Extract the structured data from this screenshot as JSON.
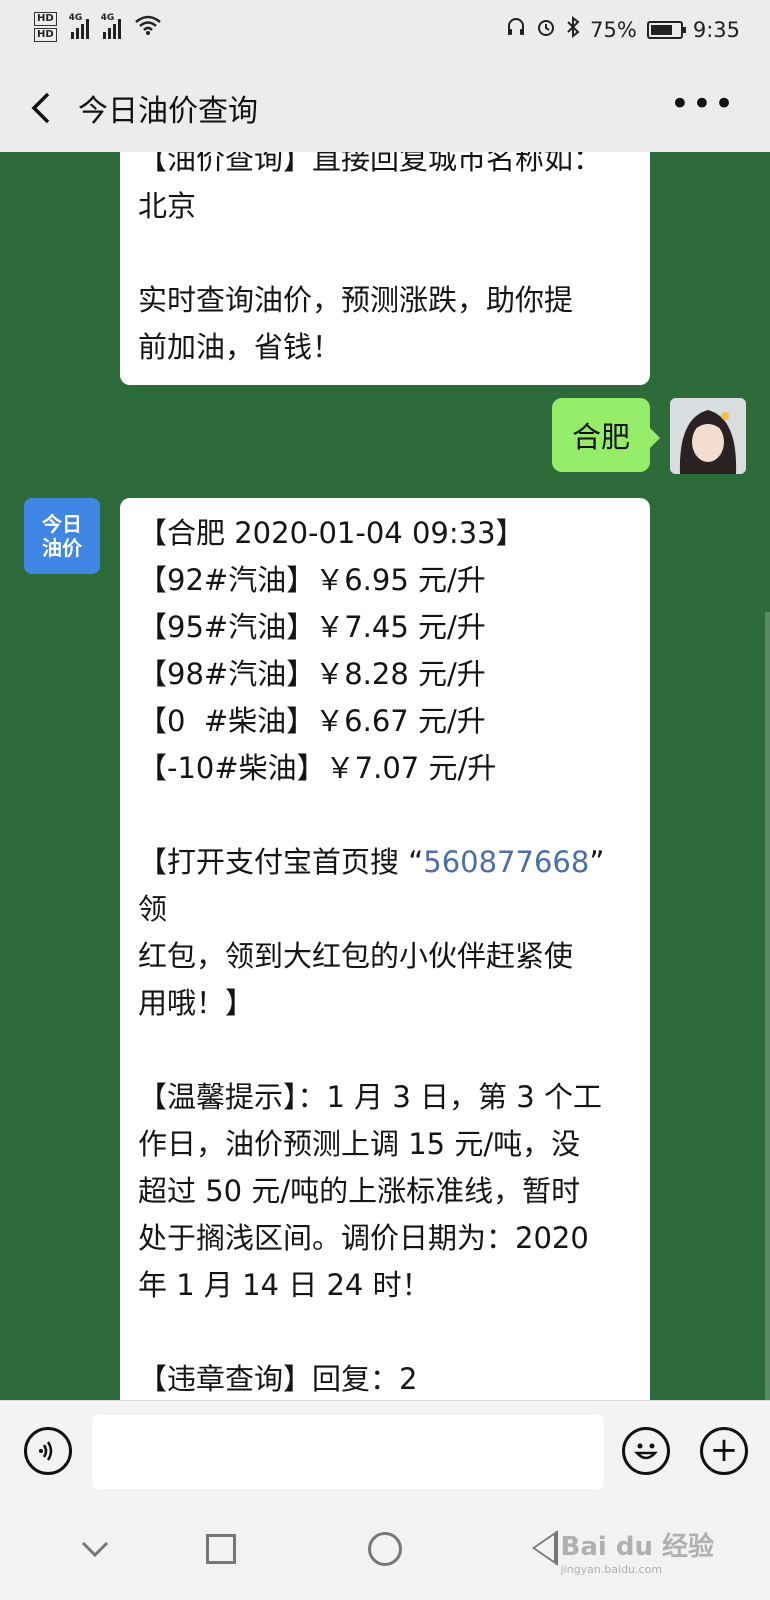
{
  "status": {
    "hd1": "HD",
    "hd2": "HD",
    "net1": "4G",
    "net2": "4G",
    "battery": "75%",
    "battery_level": 0.75,
    "time": "9:35"
  },
  "header": {
    "title": "今日油价查询"
  },
  "messages": {
    "bot_intro": {
      "line1": "【油价查询】直接回复城市名称如：",
      "line2": "北京",
      "line3": "实时查询油价，预测涨跌，助你提",
      "line4": "前加油，省钱！"
    },
    "user": {
      "text": "合肥"
    },
    "bot_reply": {
      "header": "【合肥 2020-01-04 09:33】",
      "prices": [
        "【92#汽油】￥6.95 元/升",
        "【95#汽油】￥7.45 元/升",
        "【98#汽油】￥8.28 元/升",
        "【0  #柴油】￥6.67 元/升",
        "【-10#柴油】￥7.07 元/升"
      ],
      "promo_prefix": "【打开支付宝首页搜 “",
      "promo_code": "560877668",
      "promo_suffix": "” 领",
      "promo_line2": "红包，领到大红包的小伙伴赶紧使",
      "promo_line3": "用哦！】",
      "tip_line1": "【温馨提示】：1 月 3 日，第 3 个工",
      "tip_line2": "作日，油价预测上调 15 元/吨，没",
      "tip_line3": "超过 50 元/吨的上涨标准线，暂时",
      "tip_line4": "处于搁浅区间。调价日期为：2020",
      "tip_line5": "年 1 月 14 日 24 时！",
      "violation": "【违章查询】回复：2"
    }
  },
  "bot_avatar": {
    "line1": "今日",
    "line2": "油价"
  },
  "watermark": {
    "text": "Bai du 经验",
    "sub": "jingyan.baidu.com"
  }
}
